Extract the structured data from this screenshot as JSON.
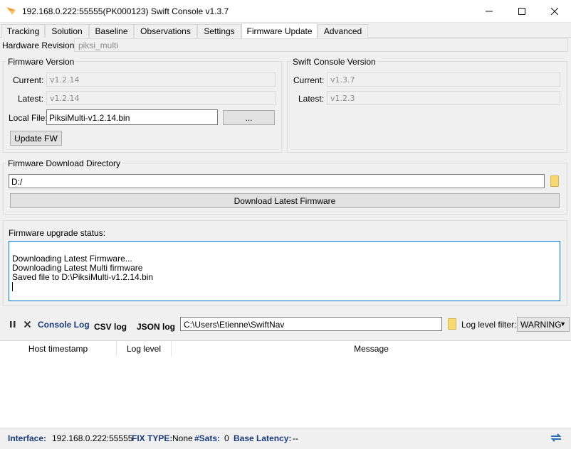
{
  "window": {
    "title": "192.168.0.222:55555(PK000123) Swift Console v1.3.7",
    "minimize": "—",
    "maximize": "☐",
    "close": "✕"
  },
  "tabs": [
    {
      "label": "Tracking"
    },
    {
      "label": "Solution"
    },
    {
      "label": "Baseline"
    },
    {
      "label": "Observations"
    },
    {
      "label": "Settings"
    },
    {
      "label": "Firmware Update",
      "active": true
    },
    {
      "label": "Advanced"
    }
  ],
  "hardware": {
    "label": "Hardware Revision:",
    "value": "piksi_multi"
  },
  "firmware_version": {
    "title": "Firmware Version",
    "current_label": "Current:",
    "current_value": "v1.2.14",
    "latest_label": "Latest:",
    "latest_value": "v1.2.14",
    "local_file_label": "Local File:",
    "local_file_value": "PiksiMulti-v1.2.14.bin",
    "browse_label": "...",
    "update_label": "Update FW"
  },
  "console_version": {
    "title": "Swift Console Version",
    "current_label": "Current:",
    "current_value": "v1.3.7",
    "latest_label": "Latest:",
    "latest_value": "v1.2.3"
  },
  "download": {
    "title": "Firmware Download Directory",
    "directory": "D:/",
    "download_label": "Download Latest Firmware"
  },
  "upgrade_status": {
    "title": "Firmware upgrade status:",
    "lines": [
      "Downloading Latest Firmware...",
      "Downloading Latest Multi firmware",
      "Saved file to D:\\PiksiMulti-v1.2.14.bin"
    ]
  },
  "log_toolbar": {
    "pause_icon": "pause-icon",
    "clear_icon": "close-icon",
    "console_log_label": "Console Log",
    "csv_log_label": "CSV log",
    "json_log_label": "JSON log",
    "path": "C:\\Users\\Etienne\\SwiftNav",
    "filter_label": "Log level filter:",
    "filter_value": "WARNING"
  },
  "log_table": {
    "columns": [
      "Host timestamp",
      "Log level",
      "Message"
    ]
  },
  "statusbar": {
    "interface_label": "Interface:",
    "interface_value": "192.168.0.222:55555",
    "fix_label": "FIX TYPE:",
    "fix_value": "None",
    "sats_label": "#Sats:",
    "sats_value": "0",
    "latency_label": "Base Latency:",
    "latency_value": "--"
  },
  "colors": {
    "accent": "#0078d7",
    "status_key": "#1a3b7a",
    "console_log_link": "#1a3b7a"
  }
}
